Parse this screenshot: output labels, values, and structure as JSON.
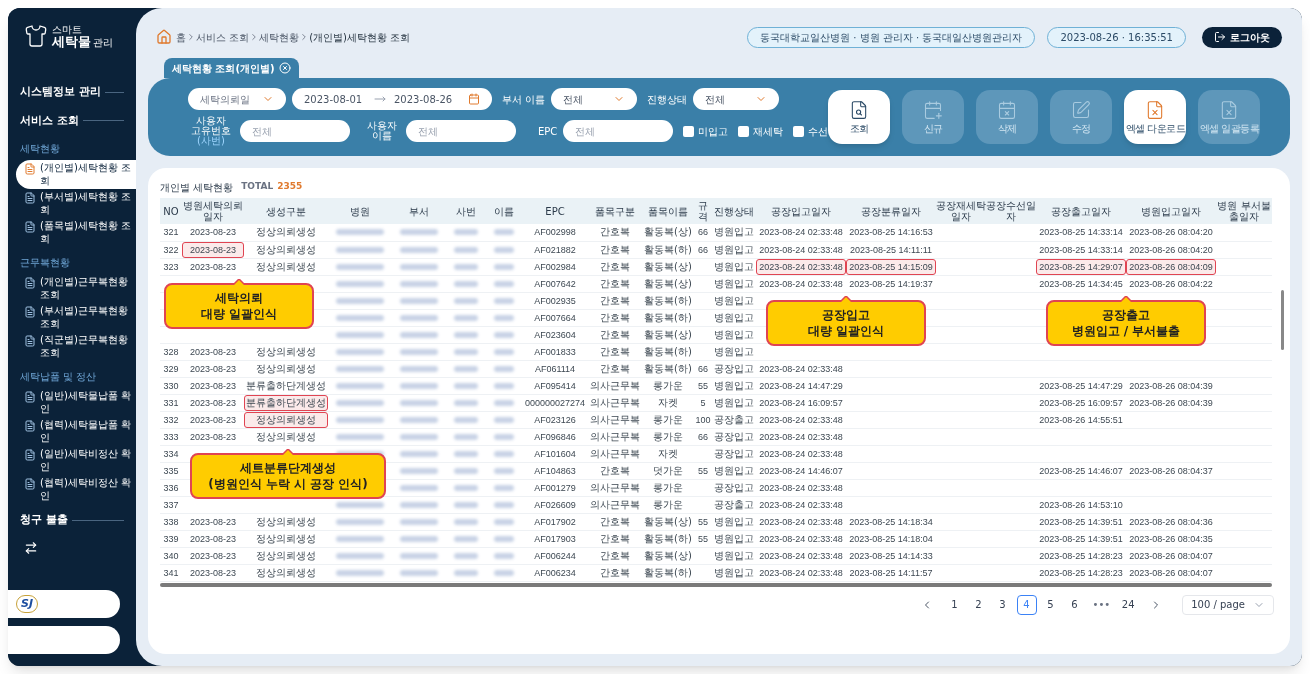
{
  "sidebar": {
    "logo": {
      "small": "스마트",
      "main": "세탁물",
      "suffix": "관리"
    },
    "sections": [
      {
        "kind": "heading",
        "label": "시스템정보 관리"
      },
      {
        "kind": "heading",
        "label": "서비스 조회"
      },
      {
        "kind": "group",
        "label": "세탁현황",
        "items": [
          {
            "label": "(개인별)세탁현황 조회",
            "selected": true
          },
          {
            "label": "(부서별)세탁현황 조회",
            "selected": false
          },
          {
            "label": "(품목별)세탁현황 조회",
            "selected": false
          }
        ]
      },
      {
        "kind": "group",
        "label": "근무복현황",
        "items": [
          {
            "label": "(개인별)근무복현황 조회",
            "selected": false
          },
          {
            "label": "(부서별)근무복현황 조회",
            "selected": false
          },
          {
            "label": "(직군별)근무복현황 조회",
            "selected": false
          }
        ]
      },
      {
        "kind": "group",
        "label": "세탁납품 및 정산",
        "items": [
          {
            "label": "(일반)세탁물납품 확인",
            "selected": false
          },
          {
            "label": "(협력)세탁물납품 확인",
            "selected": false
          },
          {
            "label": "(일반)세탁비정산 확인",
            "selected": false
          },
          {
            "label": "(협력)세탁비정산 확인",
            "selected": false
          }
        ]
      },
      {
        "kind": "heading",
        "label": "청구 불출"
      },
      {
        "kind": "swap"
      }
    ],
    "partner_logo": "SJ"
  },
  "header": {
    "breadcrumb": [
      "홈",
      "서비스 조회",
      "세탁현황",
      "(개인별)세탁현황 조회"
    ],
    "user_info": "동국대학교일산병원 · 병원 관리자 · 동국대일산병원관리자",
    "datetime": "2023-08-26 · 16:35:51",
    "logout": "로그아웃"
  },
  "tabs": [
    {
      "label": "세탁현황 조회(개인별)",
      "selected": true
    }
  ],
  "filters": {
    "date_type": "세탁의뢰일",
    "date_from": "2023-08-01",
    "date_to": "2023-08-26",
    "dept": {
      "label": "부서 이름",
      "value": "전체"
    },
    "status": {
      "label": "진행상태",
      "value": "전체"
    },
    "user_id": {
      "label_lines": [
        "사용자",
        "고유번호"
      ],
      "label_note": "(사번)",
      "placeholder": "전체"
    },
    "user_name": {
      "label_lines": [
        "사용자",
        "이름"
      ],
      "placeholder": "전체"
    },
    "epc": {
      "label": "EPC",
      "placeholder": "전체"
    },
    "checkboxes": [
      {
        "label": "미입고",
        "checked": false
      },
      {
        "label": "재세탁",
        "checked": false
      },
      {
        "label": "수선",
        "checked": false
      }
    ]
  },
  "actions": [
    {
      "kind": "search",
      "label": "조회",
      "disabled": false
    },
    {
      "kind": "new",
      "label": "신규",
      "disabled": true
    },
    {
      "kind": "delete",
      "label": "삭제",
      "disabled": true
    },
    {
      "kind": "edit",
      "label": "수정",
      "disabled": true
    },
    {
      "kind": "excel",
      "label": "엑셀 다운로드",
      "disabled": false
    },
    {
      "kind": "upload",
      "label": "엑셀 일괄등록",
      "disabled": true
    }
  ],
  "table": {
    "title": "개인별 세탁현황",
    "total_label": "TOTAL",
    "total": "2355",
    "columns": [
      {
        "label": "NO",
        "kind": "number"
      },
      {
        "label": "병원세탁의뢰일자",
        "kind": "number"
      },
      {
        "label": "생성구분",
        "kind": "text"
      },
      {
        "label": "병원",
        "kind": "blurred"
      },
      {
        "label": "부서",
        "kind": "blurred"
      },
      {
        "label": "사번",
        "kind": "blurred"
      },
      {
        "label": "이름",
        "kind": "blurred"
      },
      {
        "label": "EPC",
        "kind": "number"
      },
      {
        "label": "품목구분",
        "kind": "text"
      },
      {
        "label": "품목이름",
        "kind": "text"
      },
      {
        "label": "규격",
        "kind": "number"
      },
      {
        "label": "진행상태",
        "kind": "text"
      },
      {
        "label": "공장입고일자",
        "kind": "number"
      },
      {
        "label": "공장분류일자",
        "kind": "number"
      },
      {
        "label": "공장재세탁일자",
        "kind": "number"
      },
      {
        "label": "공장수선일자",
        "kind": "number"
      },
      {
        "label": "공장출고일자",
        "kind": "number"
      },
      {
        "label": "병원입고일자",
        "kind": "number"
      },
      {
        "label": "병원 부서불출일자",
        "kind": "number"
      }
    ],
    "rows": [
      {
        "cells": [
          {
            "text": "321",
            "highlighted": false
          },
          {
            "text": "2023-08-23",
            "highlighted": false
          },
          {
            "text": "정상의뢰생성",
            "highlighted": false
          },
          null,
          null,
          null,
          null,
          {
            "text": "AF002998",
            "highlighted": false
          },
          {
            "text": "간호복",
            "highlighted": false
          },
          {
            "text": "활동복(상)",
            "highlighted": false
          },
          {
            "text": "66",
            "highlighted": false
          },
          {
            "text": "병원입고",
            "highlighted": false
          },
          {
            "text": "2023-08-24 02:33:48",
            "highlighted": false
          },
          {
            "text": "2023-08-25 14:16:53",
            "highlighted": false
          },
          null,
          null,
          {
            "text": "2023-08-25 14:33:14",
            "highlighted": false
          },
          {
            "text": "2023-08-26 08:04:20",
            "highlighted": false
          },
          null
        ]
      },
      {
        "cells": [
          {
            "text": "322",
            "highlighted": false
          },
          {
            "text": "2023-08-23",
            "highlighted": true
          },
          {
            "text": "정상의뢰생성",
            "highlighted": false
          },
          null,
          null,
          null,
          null,
          {
            "text": "AF021882",
            "highlighted": false
          },
          {
            "text": "간호복",
            "highlighted": false
          },
          {
            "text": "활동복(하)",
            "highlighted": false
          },
          {
            "text": "66",
            "highlighted": false
          },
          {
            "text": "병원입고",
            "highlighted": false
          },
          {
            "text": "2023-08-24 02:33:48",
            "highlighted": false
          },
          {
            "text": "2023-08-25 14:11:11",
            "highlighted": false
          },
          null,
          null,
          {
            "text": "2023-08-25 14:33:14",
            "highlighted": false
          },
          {
            "text": "2023-08-26 08:04:20",
            "highlighted": false
          },
          null
        ]
      },
      {
        "cells": [
          {
            "text": "323",
            "highlighted": false
          },
          {
            "text": "2023-08-23",
            "highlighted": false
          },
          {
            "text": "정상의뢰생성",
            "highlighted": false
          },
          null,
          null,
          null,
          null,
          {
            "text": "AF002984",
            "highlighted": false
          },
          {
            "text": "간호복",
            "highlighted": false
          },
          {
            "text": "활동복(상)",
            "highlighted": false
          },
          null,
          {
            "text": "병원입고",
            "highlighted": false
          },
          {
            "text": "2023-08-24 02:33:48",
            "highlighted": true
          },
          {
            "text": "2023-08-25 14:15:09",
            "highlighted": true
          },
          null,
          null,
          {
            "text": "2023-08-25 14:29:07",
            "highlighted": true
          },
          {
            "text": "2023-08-26 08:04:09",
            "highlighted": true
          },
          null
        ]
      },
      {
        "cells": [
          null,
          null,
          null,
          null,
          null,
          null,
          null,
          {
            "text": "AF007642",
            "highlighted": false
          },
          {
            "text": "간호복",
            "highlighted": false
          },
          {
            "text": "활동복(상)",
            "highlighted": false
          },
          null,
          {
            "text": "병원입고",
            "highlighted": false
          },
          {
            "text": "2023-08-24 02:33:48",
            "highlighted": false
          },
          {
            "text": "2023-08-25 14:19:37",
            "highlighted": false
          },
          null,
          null,
          {
            "text": "2023-08-25 14:34:45",
            "highlighted": false
          },
          {
            "text": "2023-08-26 08:04:22",
            "highlighted": false
          },
          null
        ]
      },
      {
        "cells": [
          null,
          null,
          null,
          null,
          null,
          null,
          null,
          {
            "text": "AF002935",
            "highlighted": false
          },
          {
            "text": "간호복",
            "highlighted": false
          },
          {
            "text": "활동복(하)",
            "highlighted": false
          },
          null,
          {
            "text": "병원입고",
            "highlighted": false
          },
          null,
          null,
          null,
          null,
          null,
          null,
          null
        ]
      },
      {
        "cells": [
          null,
          null,
          null,
          null,
          null,
          null,
          null,
          {
            "text": "AF007664",
            "highlighted": false
          },
          {
            "text": "간호복",
            "highlighted": false
          },
          {
            "text": "활동복(하)",
            "highlighted": false
          },
          null,
          {
            "text": "병원입고",
            "highlighted": false
          },
          null,
          null,
          null,
          null,
          null,
          null,
          null
        ]
      },
      {
        "cells": [
          null,
          null,
          null,
          null,
          null,
          null,
          null,
          {
            "text": "AF023604",
            "highlighted": false
          },
          {
            "text": "간호복",
            "highlighted": false
          },
          {
            "text": "활동복(상)",
            "highlighted": false
          },
          null,
          {
            "text": "병원입고",
            "highlighted": false
          },
          null,
          null,
          null,
          null,
          null,
          null,
          null
        ]
      },
      {
        "cells": [
          {
            "text": "328",
            "highlighted": false
          },
          {
            "text": "2023-08-23",
            "highlighted": false
          },
          {
            "text": "정상의뢰생성",
            "highlighted": false
          },
          null,
          null,
          null,
          null,
          {
            "text": "AF001833",
            "highlighted": false
          },
          {
            "text": "간호복",
            "highlighted": false
          },
          {
            "text": "활동복(하)",
            "highlighted": false
          },
          null,
          {
            "text": "병원입고",
            "highlighted": false
          },
          null,
          null,
          null,
          null,
          null,
          null,
          null
        ]
      },
      {
        "cells": [
          {
            "text": "329",
            "highlighted": false
          },
          {
            "text": "2023-08-23",
            "highlighted": false
          },
          {
            "text": "정상의뢰생성",
            "highlighted": false
          },
          null,
          null,
          null,
          null,
          {
            "text": "AF061114",
            "highlighted": false
          },
          {
            "text": "간호복",
            "highlighted": false
          },
          {
            "text": "활동복(하)",
            "highlighted": false
          },
          {
            "text": "66",
            "highlighted": false
          },
          {
            "text": "공장입고",
            "highlighted": false
          },
          {
            "text": "2023-08-24 02:33:48",
            "highlighted": false
          },
          null,
          null,
          null,
          null,
          null,
          null
        ]
      },
      {
        "cells": [
          {
            "text": "330",
            "highlighted": false
          },
          {
            "text": "2023-08-23",
            "highlighted": false
          },
          {
            "text": "분류출하단계생성",
            "highlighted": false
          },
          null,
          null,
          null,
          null,
          {
            "text": "AF095414",
            "highlighted": false
          },
          {
            "text": "의사근무복",
            "highlighted": false
          },
          {
            "text": "롱가운",
            "highlighted": false
          },
          {
            "text": "55",
            "highlighted": false
          },
          {
            "text": "병원입고",
            "highlighted": false
          },
          {
            "text": "2023-08-24 14:47:29",
            "highlighted": false
          },
          null,
          null,
          null,
          {
            "text": "2023-08-25 14:47:29",
            "highlighted": false
          },
          {
            "text": "2023-08-26 08:04:39",
            "highlighted": false
          },
          null
        ]
      },
      {
        "cells": [
          {
            "text": "331",
            "highlighted": false
          },
          {
            "text": "2023-08-23",
            "highlighted": false
          },
          {
            "text": "분류출하단계생성",
            "highlighted": true
          },
          null,
          null,
          null,
          null,
          {
            "text": "000000027274",
            "highlighted": false
          },
          {
            "text": "의사근무복",
            "highlighted": false
          },
          {
            "text": "자켓",
            "highlighted": false
          },
          {
            "text": "5",
            "highlighted": false
          },
          {
            "text": "병원입고",
            "highlighted": false
          },
          {
            "text": "2023-08-24 16:09:57",
            "highlighted": false
          },
          null,
          null,
          null,
          {
            "text": "2023-08-25 16:09:57",
            "highlighted": false
          },
          {
            "text": "2023-08-26 08:04:39",
            "highlighted": false
          },
          null
        ]
      },
      {
        "cells": [
          {
            "text": "332",
            "highlighted": false
          },
          {
            "text": "2023-08-23",
            "highlighted": false
          },
          {
            "text": "정상의뢰생성",
            "highlighted": true
          },
          null,
          null,
          null,
          null,
          {
            "text": "AF023126",
            "highlighted": false
          },
          {
            "text": "의사근무복",
            "highlighted": false
          },
          {
            "text": "롱가운",
            "highlighted": false
          },
          {
            "text": "100",
            "highlighted": false
          },
          {
            "text": "공장출고",
            "highlighted": false
          },
          {
            "text": "2023-08-24 02:33:48",
            "highlighted": false
          },
          null,
          null,
          null,
          {
            "text": "2023-08-26 14:55:51",
            "highlighted": false
          },
          null,
          null
        ]
      },
      {
        "cells": [
          {
            "text": "333",
            "highlighted": false
          },
          {
            "text": "2023-08-23",
            "highlighted": false
          },
          {
            "text": "정상의뢰생성",
            "highlighted": false
          },
          null,
          null,
          null,
          null,
          {
            "text": "AF096846",
            "highlighted": false
          },
          {
            "text": "의사근무복",
            "highlighted": false
          },
          {
            "text": "롱가운",
            "highlighted": false
          },
          {
            "text": "66",
            "highlighted": false
          },
          {
            "text": "공장입고",
            "highlighted": false
          },
          {
            "text": "2023-08-24 02:33:48",
            "highlighted": false
          },
          null,
          null,
          null,
          null,
          null,
          null
        ]
      },
      {
        "cells": [
          {
            "text": "334",
            "highlighted": false
          },
          null,
          null,
          null,
          null,
          null,
          null,
          {
            "text": "AF101604",
            "highlighted": false
          },
          {
            "text": "의사근무복",
            "highlighted": false
          },
          {
            "text": "자켓",
            "highlighted": false
          },
          null,
          {
            "text": "공장입고",
            "highlighted": false
          },
          {
            "text": "2023-08-24 02:33:48",
            "highlighted": false
          },
          null,
          null,
          null,
          null,
          null,
          null
        ]
      },
      {
        "cells": [
          {
            "text": "335",
            "highlighted": false
          },
          null,
          null,
          null,
          null,
          null,
          null,
          {
            "text": "AF104863",
            "highlighted": false
          },
          {
            "text": "간호복",
            "highlighted": false
          },
          {
            "text": "덧가운",
            "highlighted": false
          },
          {
            "text": "55",
            "highlighted": false
          },
          {
            "text": "병원입고",
            "highlighted": false
          },
          {
            "text": "2023-08-24 14:46:07",
            "highlighted": false
          },
          null,
          null,
          null,
          {
            "text": "2023-08-25 14:46:07",
            "highlighted": false
          },
          {
            "text": "2023-08-26 08:04:37",
            "highlighted": false
          },
          null
        ]
      },
      {
        "cells": [
          {
            "text": "336",
            "highlighted": false
          },
          null,
          null,
          null,
          null,
          null,
          null,
          {
            "text": "AF001279",
            "highlighted": false
          },
          {
            "text": "의사근무복",
            "highlighted": false
          },
          {
            "text": "롱가운",
            "highlighted": false
          },
          null,
          {
            "text": "공장입고",
            "highlighted": false
          },
          {
            "text": "2023-08-24 02:33:48",
            "highlighted": false
          },
          null,
          null,
          null,
          null,
          null,
          null
        ]
      },
      {
        "cells": [
          {
            "text": "337",
            "highlighted": false
          },
          null,
          null,
          null,
          null,
          null,
          null,
          {
            "text": "AF026609",
            "highlighted": false
          },
          {
            "text": "의사근무복",
            "highlighted": false
          },
          {
            "text": "롱가운",
            "highlighted": false
          },
          null,
          {
            "text": "공장출고",
            "highlighted": false
          },
          {
            "text": "2023-08-24 02:33:48",
            "highlighted": false
          },
          null,
          null,
          null,
          {
            "text": "2023-08-26 14:53:10",
            "highlighted": false
          },
          null,
          null
        ]
      },
      {
        "cells": [
          {
            "text": "338",
            "highlighted": false
          },
          {
            "text": "2023-08-23",
            "highlighted": false
          },
          {
            "text": "정상의뢰생성",
            "highlighted": false
          },
          null,
          null,
          null,
          null,
          {
            "text": "AF017902",
            "highlighted": false
          },
          {
            "text": "간호복",
            "highlighted": false
          },
          {
            "text": "활동복(상)",
            "highlighted": false
          },
          {
            "text": "55",
            "highlighted": false
          },
          {
            "text": "병원입고",
            "highlighted": false
          },
          {
            "text": "2023-08-24 02:33:48",
            "highlighted": false
          },
          {
            "text": "2023-08-25 14:18:34",
            "highlighted": false
          },
          null,
          null,
          {
            "text": "2023-08-25 14:39:51",
            "highlighted": false
          },
          {
            "text": "2023-08-26 08:04:36",
            "highlighted": false
          },
          null
        ]
      },
      {
        "cells": [
          {
            "text": "339",
            "highlighted": false
          },
          {
            "text": "2023-08-23",
            "highlighted": false
          },
          {
            "text": "정상의뢰생성",
            "highlighted": false
          },
          null,
          null,
          null,
          null,
          {
            "text": "AF017903",
            "highlighted": false
          },
          {
            "text": "간호복",
            "highlighted": false
          },
          {
            "text": "활동복(하)",
            "highlighted": false
          },
          {
            "text": "55",
            "highlighted": false
          },
          {
            "text": "병원입고",
            "highlighted": false
          },
          {
            "text": "2023-08-24 02:33:48",
            "highlighted": false
          },
          {
            "text": "2023-08-25 14:18:04",
            "highlighted": false
          },
          null,
          null,
          {
            "text": "2023-08-25 14:39:51",
            "highlighted": false
          },
          {
            "text": "2023-08-26 08:04:35",
            "highlighted": false
          },
          null
        ]
      },
      {
        "cells": [
          {
            "text": "340",
            "highlighted": false
          },
          {
            "text": "2023-08-23",
            "highlighted": false
          },
          {
            "text": "정상의뢰생성",
            "highlighted": false
          },
          null,
          null,
          null,
          null,
          {
            "text": "AF006244",
            "highlighted": false
          },
          {
            "text": "간호복",
            "highlighted": false
          },
          {
            "text": "활동복(상)",
            "highlighted": false
          },
          null,
          {
            "text": "병원입고",
            "highlighted": false
          },
          {
            "text": "2023-08-24 02:33:48",
            "highlighted": false
          },
          {
            "text": "2023-08-25 14:14:33",
            "highlighted": false
          },
          null,
          null,
          {
            "text": "2023-08-25 14:28:23",
            "highlighted": false
          },
          {
            "text": "2023-08-26 08:04:07",
            "highlighted": false
          },
          null
        ]
      },
      {
        "cells": [
          {
            "text": "341",
            "highlighted": false
          },
          {
            "text": "2023-08-23",
            "highlighted": false
          },
          {
            "text": "정상의뢰생성",
            "highlighted": false
          },
          null,
          null,
          null,
          null,
          {
            "text": "AF006234",
            "highlighted": false
          },
          {
            "text": "간호복",
            "highlighted": false
          },
          {
            "text": "활동복(하)",
            "highlighted": false
          },
          null,
          {
            "text": "병원입고",
            "highlighted": false
          },
          {
            "text": "2023-08-24 02:33:48",
            "highlighted": false
          },
          {
            "text": "2023-08-25 14:11:57",
            "highlighted": false
          },
          null,
          null,
          {
            "text": "2023-08-25 14:28:23",
            "highlighted": false
          },
          {
            "text": "2023-08-26 08:04:07",
            "highlighted": false
          },
          null
        ]
      }
    ]
  },
  "callouts": [
    {
      "lines": [
        "세탁의뢰",
        "대량 일괄인식"
      ]
    },
    {
      "lines": [
        "공장입고",
        "대량 일괄인식"
      ]
    },
    {
      "lines": [
        "공장출고",
        "병원입고 / 부서불출"
      ]
    },
    {
      "lines": [
        "세트분류단계생성",
        "(병원인식 누락 시 공장 인식)"
      ]
    }
  ],
  "pagination": {
    "items": [
      {
        "kind": "page",
        "label": "1",
        "selected": false
      },
      {
        "kind": "page",
        "label": "2",
        "selected": false
      },
      {
        "kind": "page",
        "label": "3",
        "selected": false
      },
      {
        "kind": "page",
        "label": "4",
        "selected": true
      },
      {
        "kind": "page",
        "label": "5",
        "selected": false
      },
      {
        "kind": "page",
        "label": "6",
        "selected": false
      },
      {
        "kind": "ellipsis",
        "label": "•••"
      },
      {
        "kind": "page",
        "label": "24",
        "selected": false
      }
    ],
    "page_size": "100 / page"
  }
}
